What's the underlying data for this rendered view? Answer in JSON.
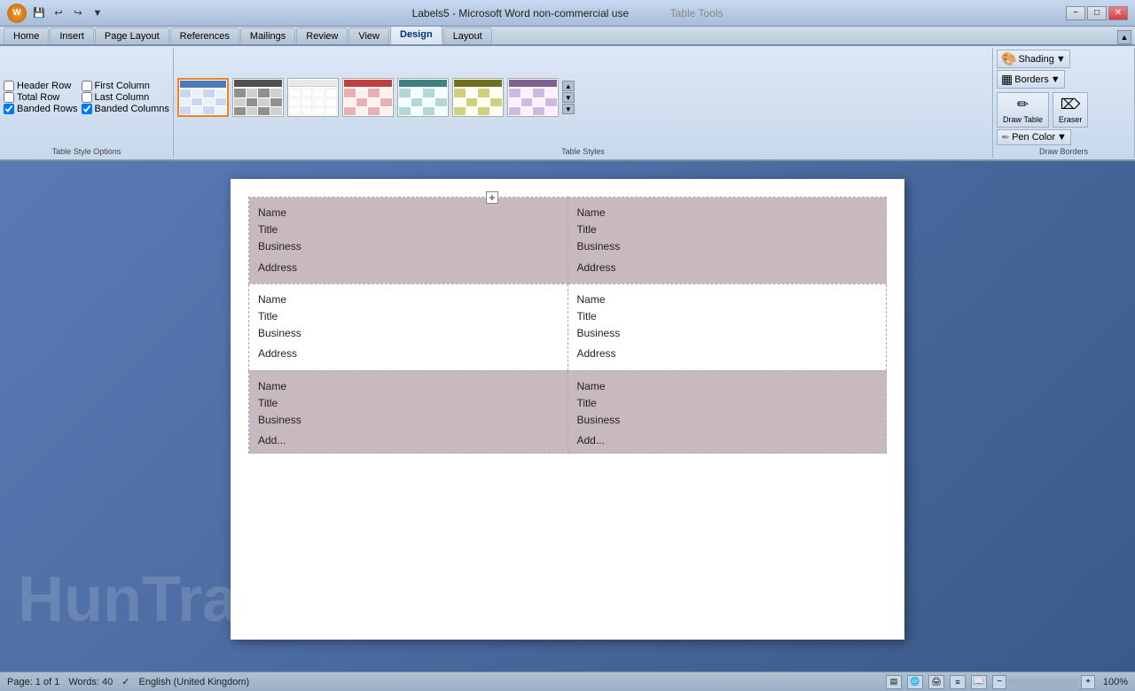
{
  "titlebar": {
    "title": "Labels5 - Microsoft Word non-commercial use",
    "table_tools": "Table Tools",
    "minimize": "−",
    "maximize": "□",
    "close": "✕"
  },
  "quickaccess": {
    "save": "💾",
    "undo": "↩",
    "redo": "↪"
  },
  "tabs": [
    {
      "id": "home",
      "label": "Home"
    },
    {
      "id": "insert",
      "label": "Insert"
    },
    {
      "id": "pagelayout",
      "label": "Page Layout"
    },
    {
      "id": "references",
      "label": "References"
    },
    {
      "id": "mailings",
      "label": "Mailings"
    },
    {
      "id": "review",
      "label": "Review"
    },
    {
      "id": "view",
      "label": "View"
    },
    {
      "id": "design",
      "label": "Design",
      "active": true
    },
    {
      "id": "layout",
      "label": "Layout"
    }
  ],
  "table_style_options": {
    "group_label": "Table Style Options",
    "checkboxes": [
      {
        "id": "header_row",
        "label": "Header Row",
        "checked": false
      },
      {
        "id": "first_column",
        "label": "First Column",
        "checked": false
      },
      {
        "id": "total_row",
        "label": "Total Row",
        "checked": false
      },
      {
        "id": "last_column",
        "label": "Last Column",
        "checked": false
      },
      {
        "id": "banded_rows",
        "label": "Banded Rows",
        "checked": true
      },
      {
        "id": "banded_columns",
        "label": "Banded Columns",
        "checked": true
      }
    ]
  },
  "table_styles": {
    "group_label": "Table Styles",
    "styles": [
      {
        "id": "s0",
        "type": "blue-selected"
      },
      {
        "id": "s1",
        "type": "dark"
      },
      {
        "id": "s2",
        "type": "plain-lines"
      },
      {
        "id": "s3",
        "type": "red"
      },
      {
        "id": "s4",
        "type": "teal"
      },
      {
        "id": "s5",
        "type": "olive"
      },
      {
        "id": "s6",
        "type": "plain"
      }
    ]
  },
  "draw_borders": {
    "group_label": "Draw Borders",
    "shading": "Shading",
    "borders": "Borders",
    "draw_table": "Draw\nTable",
    "eraser": "Eraser",
    "pen_color": "Pen Color"
  },
  "document": {
    "labels": [
      [
        {
          "name": "Name",
          "title": "Title",
          "business": "Business",
          "address": "Address"
        },
        {
          "name": "Name",
          "title": "Title",
          "business": "Business",
          "address": "Address"
        }
      ],
      [
        {
          "name": "Name",
          "title": "Title",
          "business": "Business",
          "address": "Address"
        },
        {
          "name": "Name",
          "title": "Title",
          "business": "Business",
          "address": "Address"
        }
      ],
      [
        {
          "name": "Name",
          "title": "Title",
          "business": "Business",
          "address": "Add..."
        },
        {
          "name": "Name",
          "title": "Title",
          "business": "Business",
          "address": "Add..."
        }
      ]
    ]
  },
  "statusbar": {
    "page": "Page: 1 of 1",
    "words": "Words: 40",
    "language": "English (United Kingdom)",
    "zoom": "100%"
  },
  "watermark": "HunTrail"
}
